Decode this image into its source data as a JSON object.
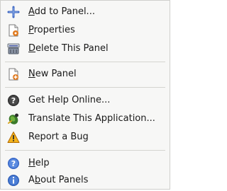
{
  "menu": {
    "items": [
      {
        "key": "add",
        "label": "Add to Panel...",
        "mnemonic": "A",
        "icon": "plus-icon"
      },
      {
        "key": "props",
        "label": "Properties",
        "mnemonic": "P",
        "icon": "properties-icon"
      },
      {
        "key": "delete",
        "label": "Delete This Panel",
        "mnemonic": "D",
        "icon": "delete-panel-icon"
      },
      {
        "key": "new",
        "label": "New Panel",
        "mnemonic": "N",
        "icon": "new-panel-icon"
      },
      {
        "key": "help-online",
        "label": "Get Help Online...",
        "mnemonic": "",
        "icon": "help-online-icon"
      },
      {
        "key": "translate",
        "label": "Translate This Application...",
        "mnemonic": "",
        "icon": "translate-icon"
      },
      {
        "key": "bug",
        "label": "Report a Bug",
        "mnemonic": "",
        "icon": "warning-icon"
      },
      {
        "key": "help",
        "label": "Help",
        "mnemonic": "H",
        "icon": "help-icon"
      },
      {
        "key": "about",
        "label": "About Panels",
        "mnemonic": "b",
        "icon": "about-icon"
      }
    ]
  },
  "colors": {
    "background": "#f7f7f6",
    "border": "#cfcfcc",
    "text": "#1a1a1a"
  }
}
